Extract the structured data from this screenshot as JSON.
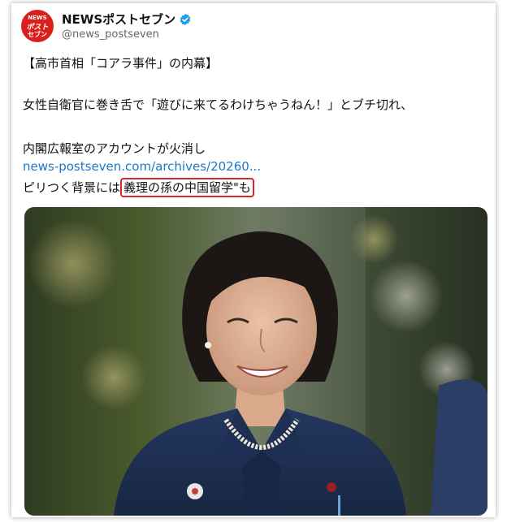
{
  "account": {
    "display_name": "NEWSポストセブン",
    "handle": "@news_postseven",
    "avatar_text_top": "NEWS",
    "avatar_text_mid": "ポスト",
    "avatar_text_bot": "セブン",
    "verified_icon": "verified-badge-icon",
    "verified_color": "#1d9bf0",
    "avatar_color": "#d9201a"
  },
  "tweet": {
    "line1": "【高市首相「コアラ事件」の内幕】",
    "line2": "女性自衛官に巻き舌で「遊びに来てるわけちゃうねん！」とブチ切れ、",
    "line3": "内閣広報室のアカウントが火消し",
    "link": "news-postseven.com/archives/20260...",
    "line4_prefix": "ピリつく背景には",
    "line4_circled": "義理の孫の中国留学\"も",
    "link_color": "#1d77c9",
    "circle_color": "#d22a2a"
  },
  "media": {
    "type": "photo",
    "subject": "woman-smiling-portrait"
  }
}
